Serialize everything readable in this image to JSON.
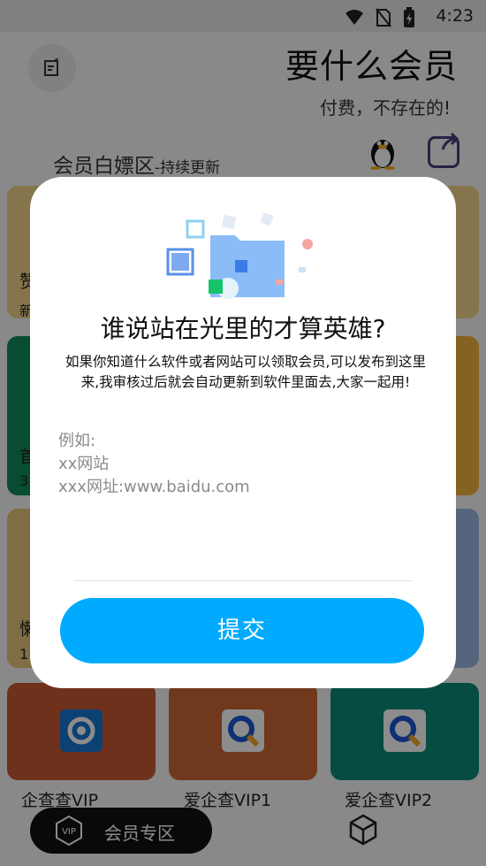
{
  "status_bar": {
    "time": "4:23"
  },
  "header": {
    "title": "要什么会员",
    "subtitle": "付费，不存在的!",
    "section_title": "会员白嫖区",
    "section_tag": "-持续更新"
  },
  "grid": {
    "left_fragments": [
      "赞",
      "新",
      "首",
      "3",
      "懒",
      "1"
    ],
    "bottom_cards": [
      {
        "label": "企查查VIP",
        "color": "#c85a33"
      },
      {
        "label": "爱企查VIP1",
        "color": "#cc6633"
      },
      {
        "label": "爱企查VIP2",
        "color": "#0e8a7a"
      }
    ]
  },
  "bottom_nav": {
    "label": "会员专区",
    "vip_badge": "VIP"
  },
  "dialog": {
    "title": "谁说站在光里的才算英雄?",
    "description": "如果你知道什么软件或者网站可以领取会员,可以发布到这里来,我审核过后就会自动更新到软件里面去,大家一起用!",
    "placeholder": "例如:\nxx网站\nxxx网址:www.baidu.com",
    "submit_label": "提交"
  },
  "colors": {
    "accent": "#00aaff",
    "overlay": "rgba(0,0,0,0.45)"
  }
}
